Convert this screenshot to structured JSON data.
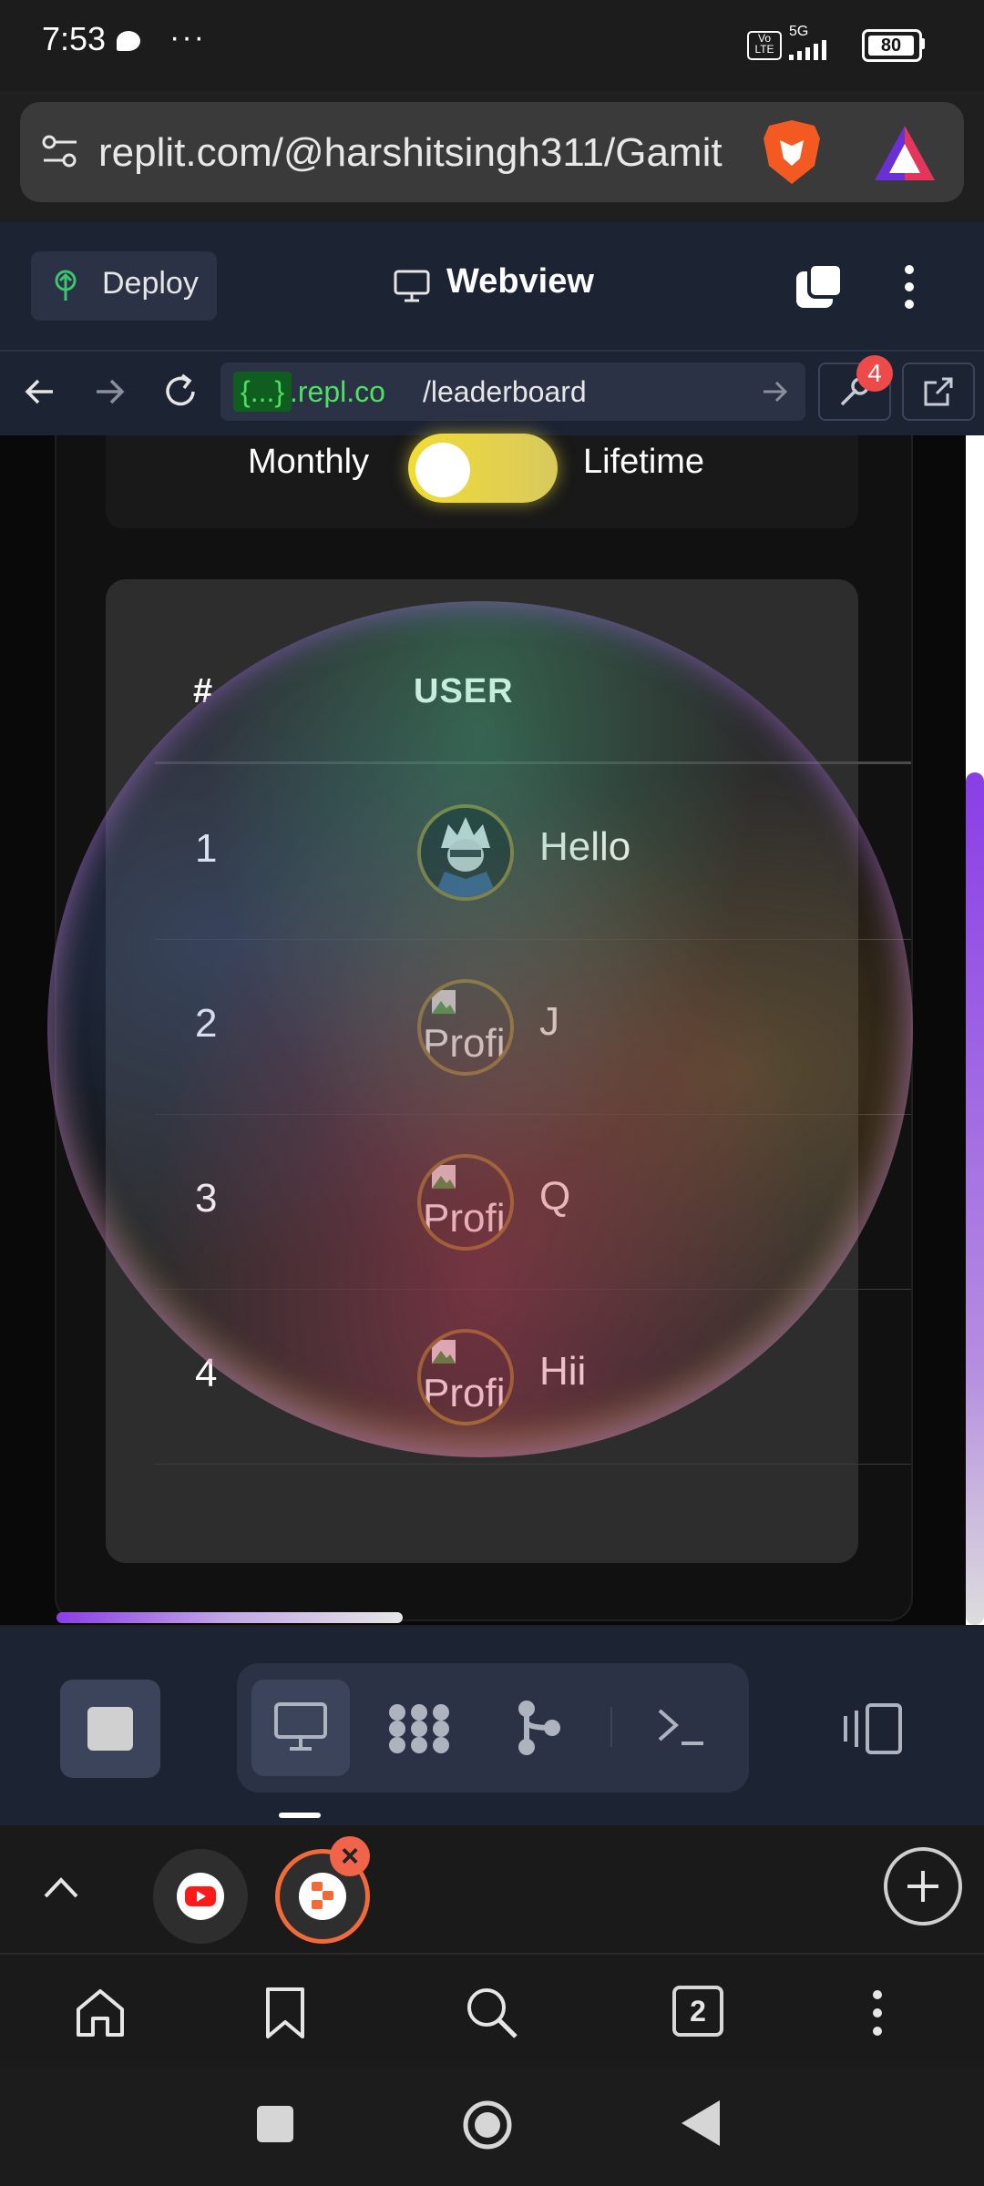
{
  "status_bar": {
    "time": "7:53",
    "more_dots": "···",
    "volte": "Vo LTE",
    "network": "5G",
    "battery": "80"
  },
  "browser": {
    "url": "replit.com/@harshitsingh311/Gamit",
    "tab_count": "2"
  },
  "replit_header": {
    "deploy_label": "Deploy",
    "webview_title": "Webview"
  },
  "webview_nav": {
    "url_host_badge": "{...}",
    "url_host_rest": ".repl.co",
    "url_path": "/leaderboard",
    "devtools_badge_count": "4"
  },
  "leaderboard": {
    "toggle": {
      "left_label": "Monthly",
      "right_label": "Lifetime",
      "selected": "Monthly"
    },
    "columns": {
      "rank": "#",
      "user": "USER"
    },
    "rows": [
      {
        "rank": "1",
        "name": "Hello",
        "avatar_alt": ""
      },
      {
        "rank": "2",
        "name": "J",
        "avatar_alt": "Profi"
      },
      {
        "rank": "3",
        "name": "Q",
        "avatar_alt": "Profi"
      },
      {
        "rank": "4",
        "name": "Hii",
        "avatar_alt": "Profi"
      }
    ]
  },
  "colors": {
    "accent_purple": "#8a3ee6",
    "toggle_yellow": "#f2dc35",
    "url_green": "#4ee063",
    "badge_red": "#ef4a4a",
    "replit_orange": "#f26a3a"
  },
  "icons": {
    "header": [
      "deploy-icon",
      "webview-icon",
      "tabs-icon",
      "menu-icon"
    ],
    "nav": [
      "back-icon",
      "forward-icon",
      "reload-icon",
      "go-icon",
      "wrench-icon",
      "open-external-icon"
    ],
    "toolbar": [
      "stop-icon",
      "webview-icon",
      "network-icon",
      "git-icon",
      "shell-icon",
      "resize-icon"
    ],
    "browser_bottom": [
      "home-icon",
      "bookmark-icon",
      "search-icon",
      "tabs-icon",
      "menu-icon"
    ]
  }
}
